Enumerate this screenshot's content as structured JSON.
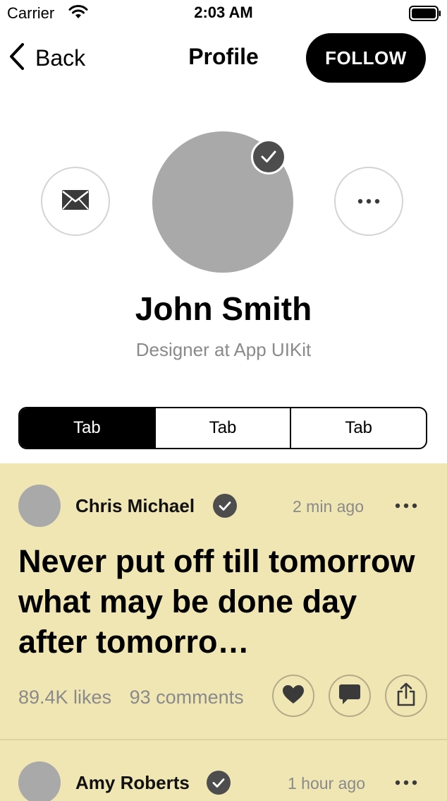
{
  "status_bar": {
    "carrier": "Carrier",
    "time": "2:03 AM"
  },
  "nav": {
    "back_label": "Back",
    "title": "Profile",
    "follow_label": "FOLLOW"
  },
  "profile": {
    "name": "John Smith",
    "subtitle": "Designer at App UIKit"
  },
  "tabs": [
    {
      "label": "Tab",
      "selected": true
    },
    {
      "label": "Tab",
      "selected": false
    },
    {
      "label": "Tab",
      "selected": false
    }
  ],
  "posts": [
    {
      "author": "Chris Michael",
      "verified": true,
      "time": "2 min ago",
      "text": "Never put off till tomorrow what may be done day after tomorro…",
      "likes": "89.4K likes",
      "comments": "93 comments"
    },
    {
      "author": "Amy Roberts",
      "verified": true,
      "time": "1 hour ago"
    }
  ],
  "icons": {
    "back": "chevron-left-icon",
    "mail": "envelope-icon",
    "more": "more-horizontal-icon",
    "verified": "checkmark-badge-icon",
    "like": "heart-icon",
    "comment": "speech-bubble-icon",
    "share": "share-icon"
  },
  "colors": {
    "accent": "#000000",
    "feed_background": "#f0e6b4",
    "avatar_placeholder": "#a9a9a9",
    "secondary_text": "#8a8a8a"
  }
}
